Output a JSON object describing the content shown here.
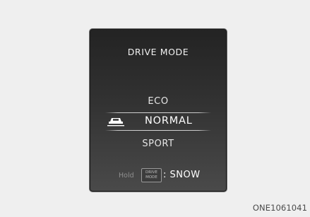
{
  "panel": {
    "title": "DRIVE MODE",
    "modes": {
      "eco": "ECO",
      "normal": "NORMAL",
      "sport": "SPORT"
    },
    "selected_mode": "NORMAL",
    "hold": {
      "prefix": "Hold",
      "button_line1": "DRIVE",
      "button_line2": "MODE",
      "suffix": ": SNOW"
    }
  },
  "figure_code": "ONE1061041",
  "icons": {
    "selected": "car-icon"
  },
  "colors": {
    "background": "#efefef",
    "panel_top": "#232323",
    "panel_bottom": "#4a4a4a",
    "text": "#ffffff",
    "hold_text": "#8f8f8f"
  }
}
